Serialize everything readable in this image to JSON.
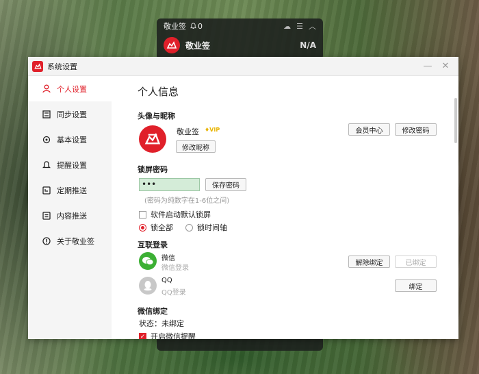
{
  "widget": {
    "title": "敬业签",
    "bell_count": "0",
    "app_name": "敬业签",
    "status": "N/A"
  },
  "window": {
    "title": "系统设置"
  },
  "sidebar": {
    "items": [
      {
        "label": "个人设置",
        "icon": "user-icon",
        "active": true
      },
      {
        "label": "同步设置",
        "icon": "sync-icon"
      },
      {
        "label": "基本设置",
        "icon": "gear-icon"
      },
      {
        "label": "提醒设置",
        "icon": "bell-icon"
      },
      {
        "label": "定期推送",
        "icon": "calendar-icon"
      },
      {
        "label": "内容推送",
        "icon": "document-icon"
      },
      {
        "label": "关于敬业签",
        "icon": "info-icon"
      }
    ]
  },
  "main": {
    "page_title": "个人信息",
    "avatar_section": {
      "title": "头像与昵称",
      "nickname": "敬业签",
      "vip_label": "VIP",
      "edit_nick_button": "修改昵称",
      "member_center_button": "会员中心",
      "change_password_button": "修改密码"
    },
    "lock_section": {
      "title": "锁屏密码",
      "password_value": "•••",
      "save_button": "保存密码",
      "hint": "(密码为纯数字在1-6位之间)",
      "auto_lock_label": "软件启动默认锁屏",
      "lock_all_label": "锁全部",
      "lock_timeline_label": "锁时间轴"
    },
    "linked_section": {
      "title": "互联登录",
      "wechat_name": "微信",
      "wechat_sub": "微信登录",
      "unbind_button": "解除绑定",
      "bound_button": "已绑定",
      "qq_name": "QQ",
      "qq_sub": "QQ登录",
      "bind_button": "绑定"
    },
    "wechat_bind_section": {
      "title": "微信绑定",
      "status": "状态：未绑定",
      "reminder_label": "开启微信提醒"
    }
  },
  "colors": {
    "brand_red": "#e0202a",
    "wechat_green": "#3cb034",
    "qq_gray": "#c8c8c8"
  }
}
